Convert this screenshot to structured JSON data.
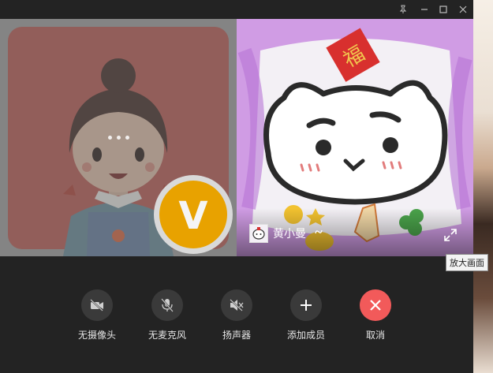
{
  "window": {
    "pin_icon": "pin-icon",
    "minimize_icon": "minimize-icon",
    "maximize_icon": "maximize-icon",
    "close_icon": "close-icon"
  },
  "participants": [
    {
      "role": "self",
      "avatar": "cartoon-girl-avatar",
      "badge": "V"
    },
    {
      "role": "remote",
      "name": "黄小曼",
      "avatar": "cat-drawing-avatar"
    }
  ],
  "tooltip": "放大画面",
  "controls": [
    {
      "id": "camera",
      "label": "无摄像头",
      "icon": "camera-off-icon"
    },
    {
      "id": "mic",
      "label": "无麦克风",
      "icon": "mic-off-icon"
    },
    {
      "id": "speaker",
      "label": "扬声器",
      "icon": "speaker-muted-icon"
    },
    {
      "id": "add",
      "label": "添加成员",
      "icon": "plus-icon"
    },
    {
      "id": "cancel",
      "label": "取消",
      "icon": "x-icon"
    }
  ],
  "colors": {
    "danger": "#f25a5a",
    "badge": "#e8a200",
    "panel": "#232323"
  }
}
